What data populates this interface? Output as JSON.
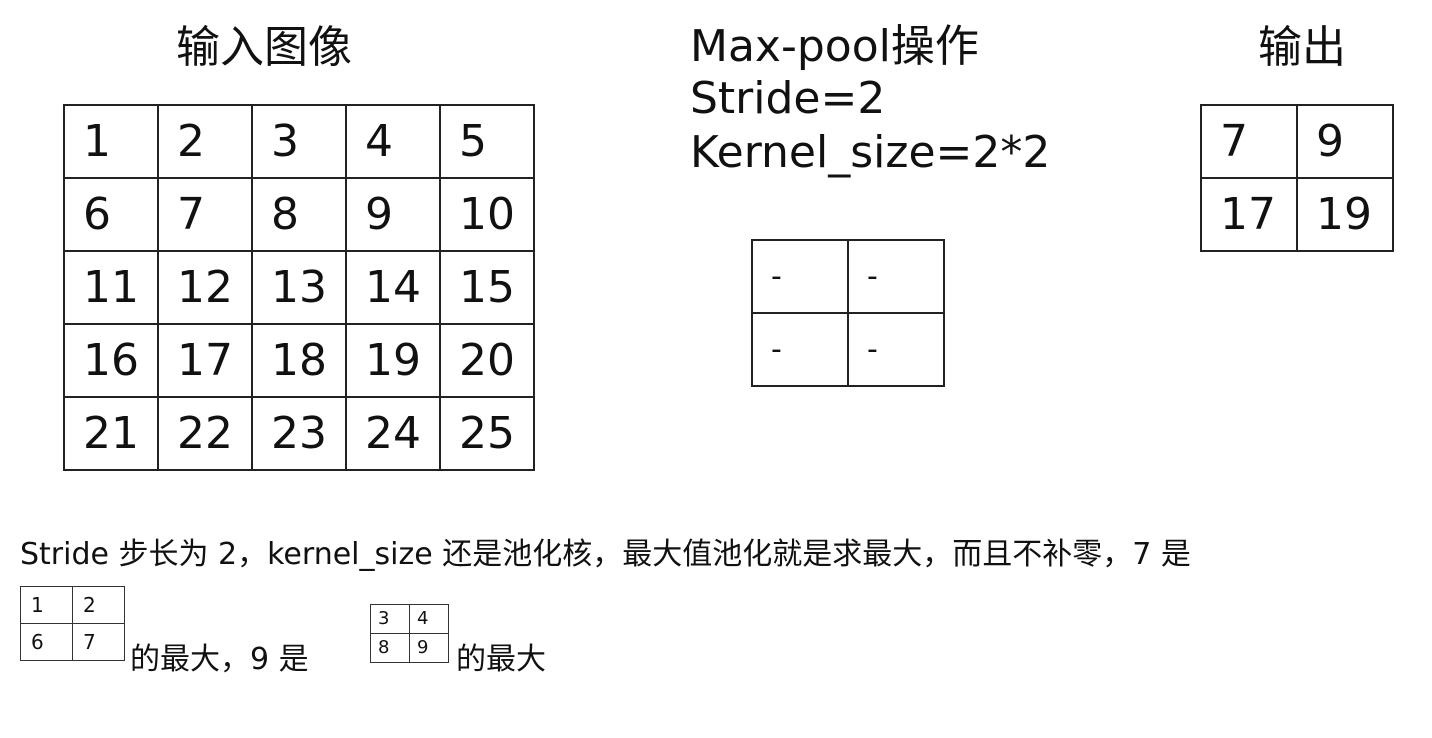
{
  "input": {
    "title": "输入图像",
    "grid": [
      [
        "1",
        "2",
        "3",
        "4",
        "5"
      ],
      [
        "6",
        "7",
        "8",
        "9",
        "10"
      ],
      [
        "11",
        "12",
        "13",
        "14",
        "15"
      ],
      [
        "16",
        "17",
        "18",
        "19",
        "20"
      ],
      [
        "21",
        "22",
        "23",
        "24",
        "25"
      ]
    ]
  },
  "operation": {
    "line1": "Max-pool操作",
    "line2": "Stride=2",
    "line3": "Kernel_size=2*2",
    "kernel": [
      [
        "-",
        "-"
      ],
      [
        "-",
        "-"
      ]
    ]
  },
  "output": {
    "title": "输出",
    "grid": [
      [
        "7",
        "9"
      ],
      [
        "17",
        "19"
      ]
    ]
  },
  "description": {
    "line1": "Stride 步长为 2，kernel_size 还是池化核，最大值池化就是求最大，而且不补零，7 是",
    "mini_a": [
      [
        "1",
        "2"
      ],
      [
        "6",
        "7"
      ]
    ],
    "text_a": "的最大，9 是",
    "mini_b": [
      [
        "3",
        "4"
      ],
      [
        "8",
        "9"
      ]
    ],
    "text_b": "的最大"
  }
}
